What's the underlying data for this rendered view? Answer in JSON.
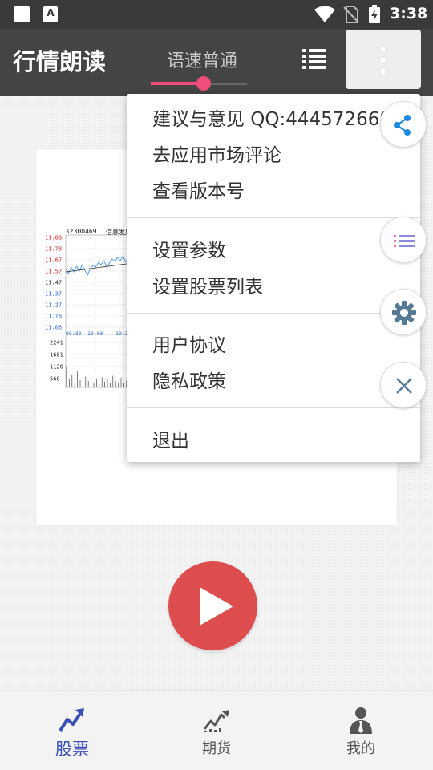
{
  "status_bar": {
    "time": "3:38",
    "icons": [
      "notification-square-icon",
      "font-a-icon",
      "wifi-icon",
      "no-sim-icon",
      "battery-charging-icon"
    ],
    "a_glyph": "A"
  },
  "app_bar": {
    "title": "行情朗读",
    "speed_label": "语速普通",
    "speed_level": 0.55,
    "accent_color": "#ef4e7b",
    "background_color": "#444444"
  },
  "menu": {
    "items": [
      {
        "label": "建议与意见 QQ:444572668"
      },
      {
        "label": "去应用市场评论"
      },
      {
        "label": "查看版本号"
      },
      {
        "label": "设置参数"
      },
      {
        "label": "设置股票列表"
      },
      {
        "label": "用户协议"
      },
      {
        "label": "隐私政策"
      },
      {
        "label": "退出"
      }
    ]
  },
  "fabs": [
    "share-icon",
    "list-icon",
    "gear-icon",
    "close-icon"
  ],
  "chart_preview": {
    "code": "sz300469",
    "name": "信息发展",
    "price_ticks": [
      "11.88",
      "11.78",
      "11.67",
      "11.57",
      "11.47",
      "11.37",
      "11.27",
      "11.16",
      "11.06"
    ],
    "time_ticks": [
      "09:30",
      "10:00",
      "10:30"
    ],
    "volume_ticks": [
      "2241",
      "1681",
      "1120",
      "560"
    ]
  },
  "bottom_nav": {
    "items": [
      {
        "label": "股票",
        "active": true
      },
      {
        "label": "期货",
        "active": false
      },
      {
        "label": "我的",
        "active": false
      }
    ],
    "active_color": "#3c4fb8"
  },
  "play_button_color": "#de4d4d"
}
